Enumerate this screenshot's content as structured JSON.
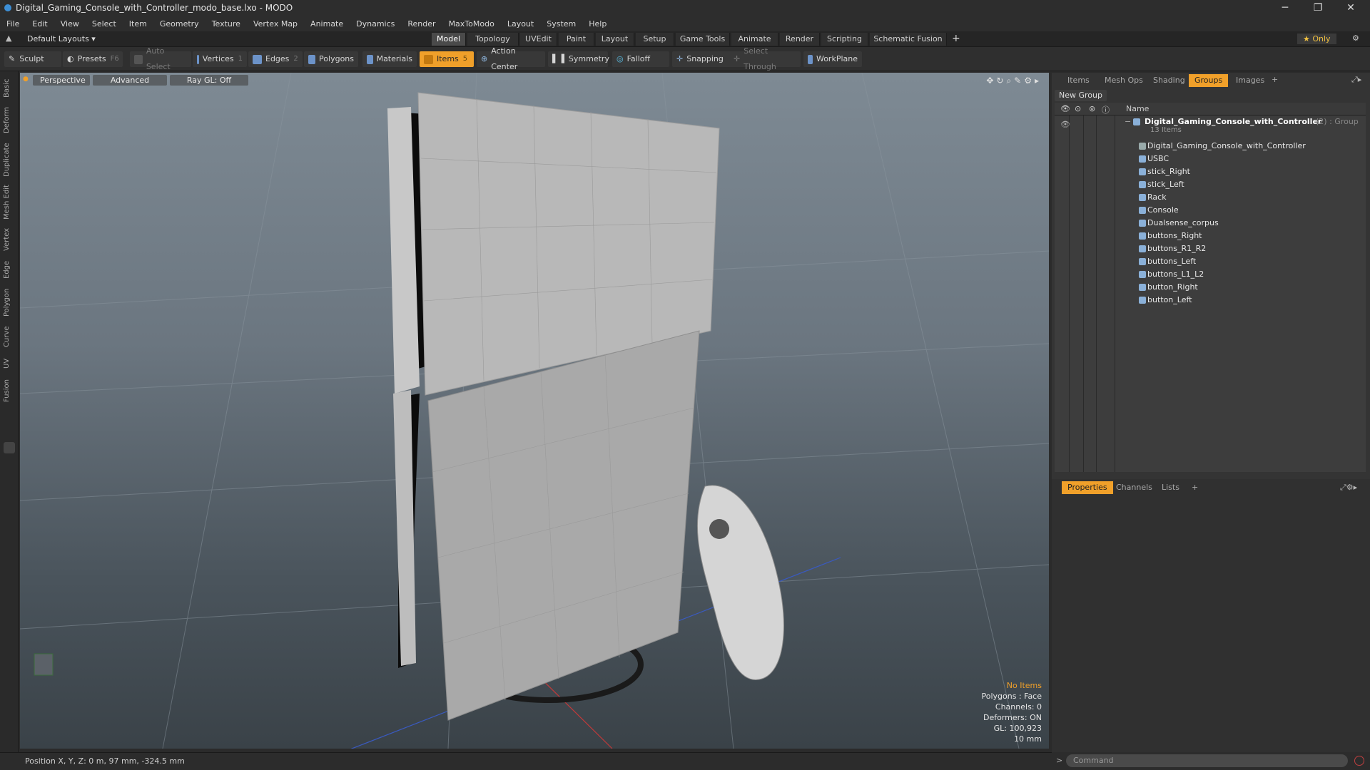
{
  "window": {
    "title": "Digital_Gaming_Console_with_Controller_modo_base.lxo - MODO"
  },
  "menu": [
    "File",
    "Edit",
    "View",
    "Select",
    "Item",
    "Geometry",
    "Texture",
    "Vertex Map",
    "Animate",
    "Dynamics",
    "Render",
    "MaxToModo",
    "Layout",
    "System",
    "Help"
  ],
  "layout_bar": {
    "layout_name": "Default Layouts ▾",
    "tabs": [
      "Model",
      "Topology",
      "UVEdit",
      "Paint",
      "Layout",
      "Setup",
      "Game Tools",
      "Animate",
      "Render",
      "Scripting",
      "Schematic Fusion"
    ],
    "active_tab": "Model",
    "only_label": "★  Only"
  },
  "toolbar": {
    "sculpt": "Sculpt",
    "presets": "Presets",
    "presets_key": "F6",
    "auto_select": "Auto Select",
    "vertices": "Vertices",
    "vertices_key": "1",
    "edges": "Edges",
    "edges_key": "2",
    "polygons": "Polygons",
    "materials": "Materials",
    "items": "Items",
    "items_key": "5",
    "action_center": "Action Center",
    "symmetry": "Symmetry",
    "falloff": "Falloff",
    "snapping": "Snapping",
    "select_through": "Select Through",
    "workplane": "WorkPlane"
  },
  "left_tabs": [
    "Basic",
    "Deform",
    "Duplicate",
    "Mesh Edit",
    "Vertex",
    "Edge",
    "Polygon",
    "Curve",
    "UV",
    "Fusion"
  ],
  "viewport": {
    "perspective": "Perspective",
    "advanced": "Advanced",
    "raygl": "Ray GL: Off",
    "stats": {
      "no_items": "No Items",
      "polygons": "Polygons : Face",
      "channels": "Channels: 0",
      "deformers": "Deformers: ON",
      "gl": "GL: 100,923",
      "scale": "10 mm"
    }
  },
  "status": {
    "position": "Position X, Y, Z:  0 m, 97 mm, -324.5 mm"
  },
  "right_panel": {
    "tabs": [
      "Items",
      "Mesh Ops",
      "Shading",
      "Groups",
      "Images"
    ],
    "active_tab": "Groups",
    "new_group": "New Group",
    "column_name": "Name",
    "group": {
      "name": "Digital_Gaming_Console_with_Controller",
      "count": "(2) : Group",
      "sub": "13 Items"
    },
    "items": [
      "Digital_Gaming_Console_with_Controller",
      "USBC",
      "stick_Right",
      "stick_Left",
      "Rack",
      "Console",
      "Dualsense_corpus",
      "buttons_Right",
      "buttons_R1_R2",
      "buttons_Left",
      "buttons_L1_L2",
      "button_Right",
      "button_Left"
    ]
  },
  "props_panel": {
    "tabs": [
      "Properties",
      "Channels",
      "Lists"
    ],
    "active_tab": "Properties"
  },
  "command": {
    "placeholder": "Command"
  },
  "colors": {
    "accent": "#f0a02a",
    "viewport_top": "#7e8a94",
    "panel": "#343434"
  }
}
